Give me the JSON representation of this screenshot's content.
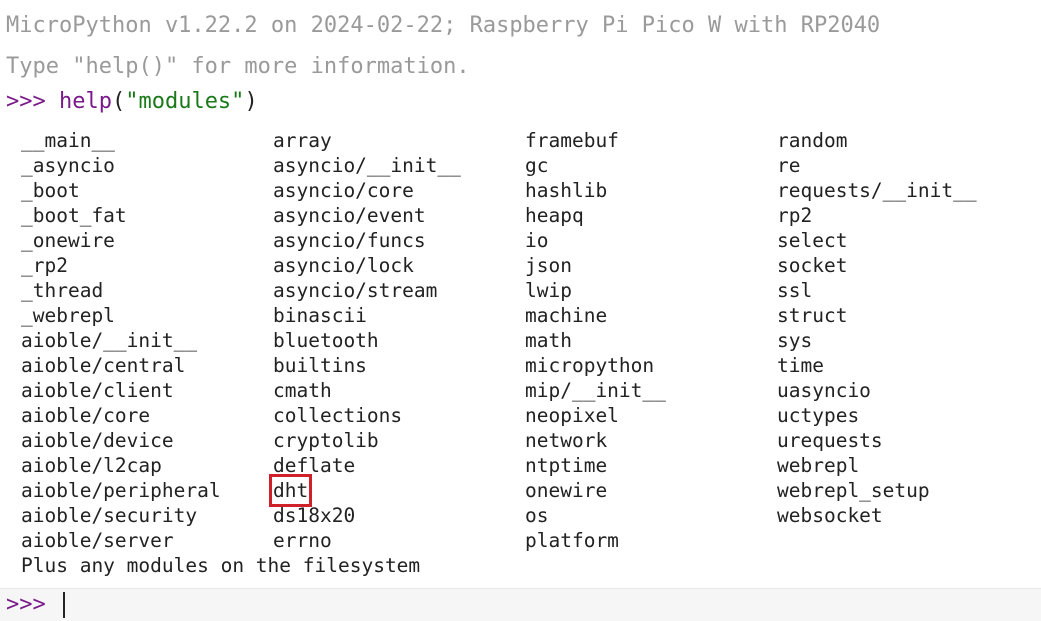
{
  "banner": {
    "line1": "MicroPython v1.22.2 on 2024-02-22; Raspberry Pi Pico W with RP2040",
    "line2": "Type \"help()\" for more information."
  },
  "command": {
    "prompt": ">>> ",
    "function": "help",
    "open_paren": "(",
    "argument": "\"modules\"",
    "close_paren": ")"
  },
  "modules": {
    "rows": [
      [
        "__main__",
        "array",
        "framebuf",
        "random"
      ],
      [
        "_asyncio",
        "asyncio/__init__",
        "gc",
        "re"
      ],
      [
        "_boot",
        "asyncio/core",
        "hashlib",
        "requests/__init__"
      ],
      [
        "_boot_fat",
        "asyncio/event",
        "heapq",
        "rp2"
      ],
      [
        "_onewire",
        "asyncio/funcs",
        "io",
        "select"
      ],
      [
        "_rp2",
        "asyncio/lock",
        "json",
        "socket"
      ],
      [
        "_thread",
        "asyncio/stream",
        "lwip",
        "ssl"
      ],
      [
        "_webrepl",
        "binascii",
        "machine",
        "struct"
      ],
      [
        "aioble/__init__",
        "bluetooth",
        "math",
        "sys"
      ],
      [
        "aioble/central",
        "builtins",
        "micropython",
        "time"
      ],
      [
        "aioble/client",
        "cmath",
        "mip/__init__",
        "uasyncio"
      ],
      [
        "aioble/core",
        "collections",
        "neopixel",
        "uctypes"
      ],
      [
        "aioble/device",
        "cryptolib",
        "network",
        "urequests"
      ],
      [
        "aioble/l2cap",
        "deflate",
        "ntptime",
        "webrepl"
      ],
      [
        "aioble/peripheral",
        "dht",
        "onewire",
        "webrepl_setup"
      ],
      [
        "aioble/security",
        "ds18x20",
        "os",
        "websocket"
      ],
      [
        "aioble/server",
        "errno",
        "platform",
        ""
      ]
    ],
    "footer": "Plus any modules on the filesystem"
  },
  "input": {
    "prompt": ">>> "
  },
  "colors": {
    "prompt": "#7a1a8a",
    "string": "#1a7a1a",
    "banner": "#9a9a9a",
    "highlight_box": "#d0202a"
  }
}
